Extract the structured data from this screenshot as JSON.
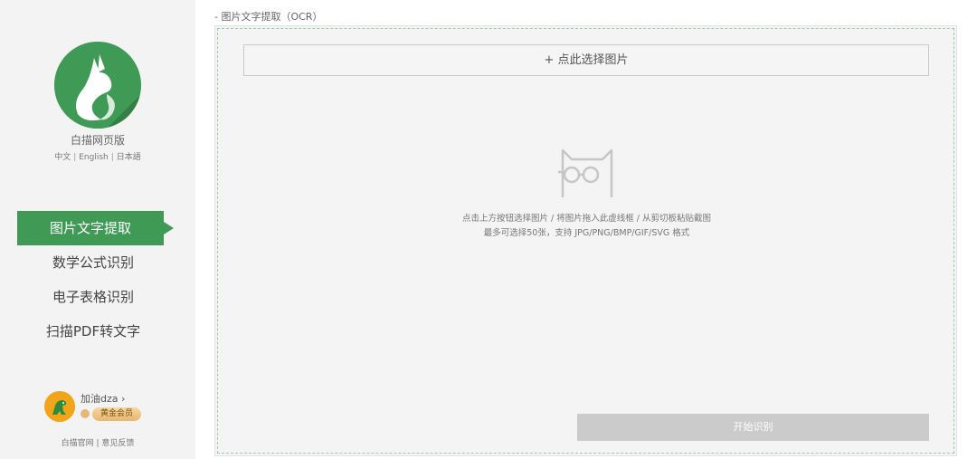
{
  "sidebar": {
    "brand_name": "白描网页版",
    "languages": [
      "中文",
      "English",
      "日本語"
    ],
    "nav": [
      {
        "label": "图片文字提取",
        "active": true
      },
      {
        "label": "数学公式识别",
        "active": false
      },
      {
        "label": "电子表格识别",
        "active": false
      },
      {
        "label": "扫描PDF转文字",
        "active": false
      }
    ],
    "user": {
      "name": "加油dza",
      "vip_label": "黄金会员"
    },
    "footer": {
      "home": "白描官网",
      "feedback": "意见反馈"
    }
  },
  "main": {
    "breadcrumb": "- 图片文字提取（OCR）",
    "select_button": "+ 点此选择图片",
    "hint_line1": "点击上方按钮选择图片 / 将图片拖入此虚线框 / 从剪切板粘贴截图",
    "hint_line2": "最多可选择50张，支持 JPG/PNG/BMP/GIF/SVG 格式",
    "start_button": "开始识别"
  },
  "colors": {
    "accent": "#3f9a55",
    "sidebar_bg": "#f3f3f3",
    "panel_bg": "#f4f4f4",
    "disabled_button": "#cbcbcb"
  }
}
